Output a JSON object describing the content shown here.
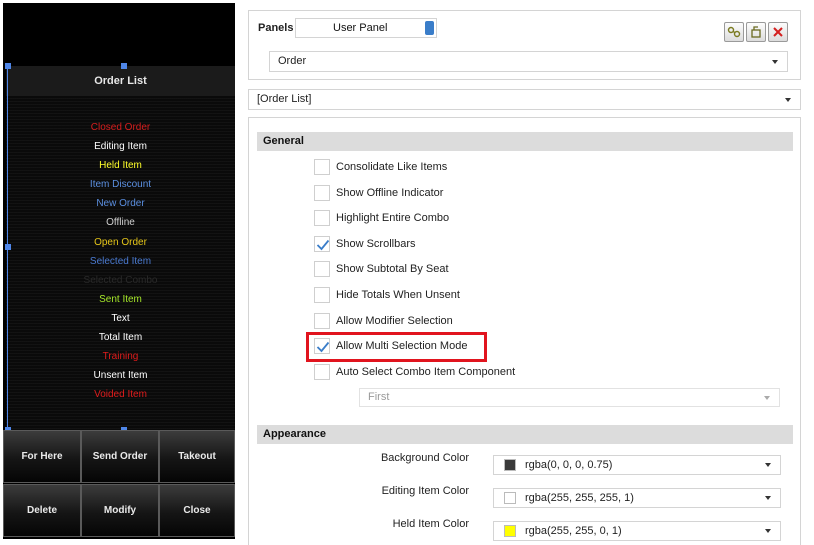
{
  "preview": {
    "title": "Order List",
    "items": [
      {
        "label": "Closed Order",
        "color": "#d81e1e"
      },
      {
        "label": "Editing Item",
        "color": "#ffffff"
      },
      {
        "label": "Held Item",
        "color": "#ffff2a"
      },
      {
        "label": "Item Discount",
        "color": "#5b8fe0"
      },
      {
        "label": "New Order",
        "color": "#5b8fe0"
      },
      {
        "label": "Offline",
        "color": "#cfcfcf"
      },
      {
        "label": "Open Order",
        "color": "#e6c619"
      },
      {
        "label": "Selected Item",
        "color": "#4a7ad0"
      },
      {
        "label": "Selected Combo",
        "color": "#2a2a2a"
      },
      {
        "label": "Sent Item",
        "color": "#a6e82a"
      },
      {
        "label": "Text",
        "color": "#ffffff"
      },
      {
        "label": "Total Item",
        "color": "#ffffff"
      },
      {
        "label": "Training",
        "color": "#e01c1c"
      },
      {
        "label": "Unsent Item",
        "color": "#ffffff"
      },
      {
        "label": "Voided Item",
        "color": "#e01c1c"
      }
    ],
    "buttons": [
      "For Here",
      "Send Order",
      "Takeout",
      "Delete",
      "Modify",
      "Close"
    ]
  },
  "top": {
    "panels_label": "Panels",
    "panel_value": "User Panel",
    "order_value": "Order",
    "tool_icons": [
      "link-settings-icon",
      "edit-panel-icon",
      "close-icon"
    ]
  },
  "component_select": "[Order List]",
  "general": {
    "header": "General",
    "options": [
      {
        "label": "Consolidate Like Items",
        "checked": false
      },
      {
        "label": "Show Offline Indicator",
        "checked": false
      },
      {
        "label": "Highlight Entire Combo",
        "checked": false
      },
      {
        "label": "Show Scrollbars",
        "checked": true
      },
      {
        "label": "Show Subtotal By Seat",
        "checked": false
      },
      {
        "label": "Hide Totals When Unsent",
        "checked": false
      },
      {
        "label": "Allow Modifier Selection",
        "checked": false
      },
      {
        "label": "Allow Multi Selection Mode",
        "checked": true
      },
      {
        "label": "Auto Select Combo Item Component",
        "checked": false
      }
    ],
    "auto_select_value": "First"
  },
  "appearance": {
    "header": "Appearance",
    "colors": [
      {
        "label": "Background Color",
        "value": "rgba(0, 0, 0, 0.75)",
        "swatch": "#3a3a3a"
      },
      {
        "label": "Editing Item Color",
        "value": "rgba(255, 255, 255, 1)",
        "swatch": "#ffffff"
      },
      {
        "label": "Held Item Color",
        "value": "rgba(255, 255, 0, 1)",
        "swatch": "#ffff00"
      }
    ]
  },
  "colors": {
    "highlight": "#e1141e",
    "check": "#3a7dc9"
  }
}
